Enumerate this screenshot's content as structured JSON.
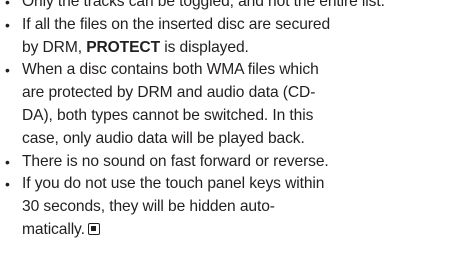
{
  "notes": [
    {
      "lines": [
        "Only the tracks can be toggled, and not the entire list."
      ],
      "partial": true
    },
    {
      "lines": [
        "If all the files on the inserted disc are secured",
        "by DRM, "
      ],
      "strong": "PROTECT",
      "tail": " is displayed."
    },
    {
      "lines": [
        "When a disc contains both WMA files which",
        "are protected by DRM and audio data (CD-",
        "DA), both types cannot be switched. In this",
        "case, only audio data will be played back."
      ]
    },
    {
      "lines": [
        "There is no sound on fast forward or reverse."
      ]
    },
    {
      "lines": [
        "If you do not use the touch panel keys within",
        "30 seconds, they will be hidden auto-",
        "matically."
      ]
    }
  ],
  "icons": {
    "end_of_section": "end-of-section-icon"
  }
}
